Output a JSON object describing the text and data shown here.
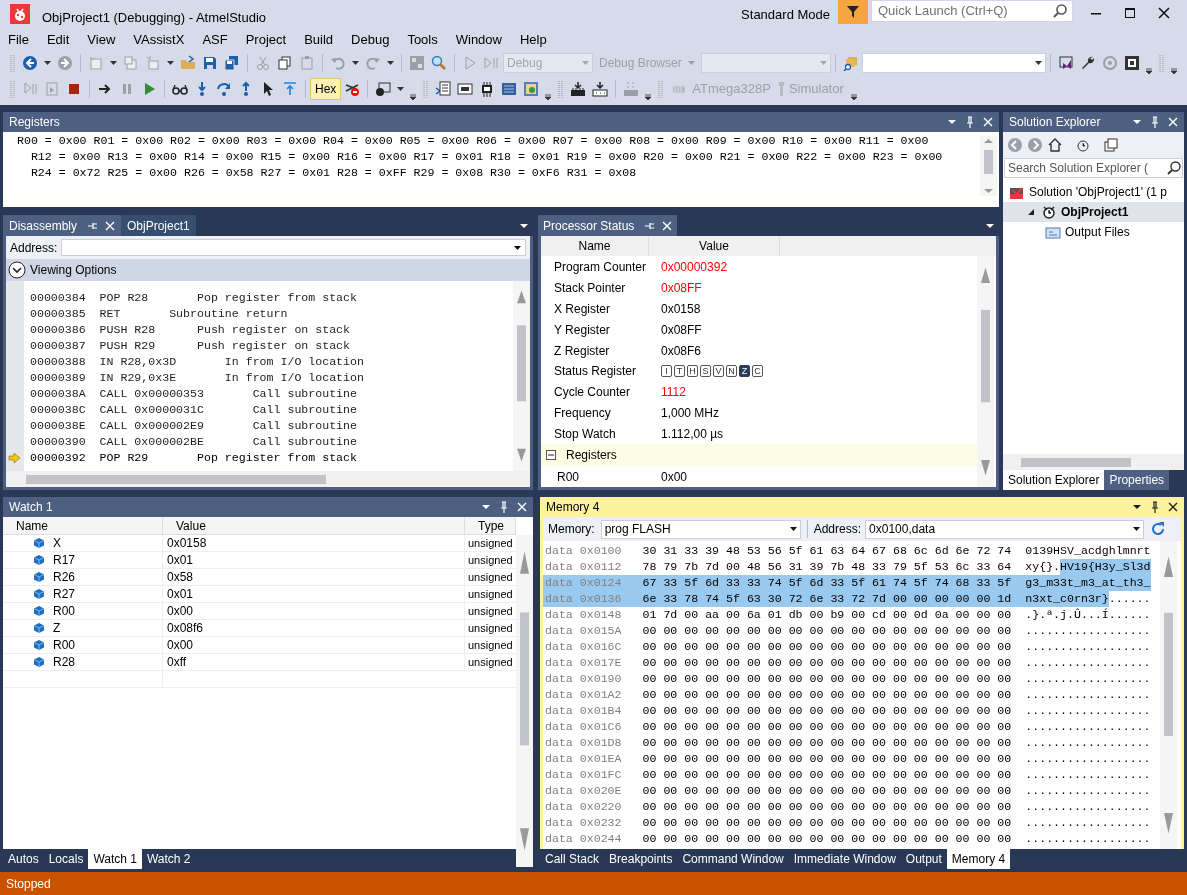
{
  "window": {
    "title": "ObjProject1 (Debugging) - AtmelStudio",
    "mode": "Standard Mode",
    "quick_launch": {
      "placeholder": "Quick Launch (Ctrl+Q)"
    }
  },
  "menu": [
    "File",
    "Edit",
    "View",
    "VAssistX",
    "ASF",
    "Project",
    "Build",
    "Debug",
    "Tools",
    "Window",
    "Help"
  ],
  "toolbar": {
    "configuration": {
      "value": "Debug",
      "disabled": true
    },
    "debug_browser": {
      "label": "Debug Browser",
      "disabled": true
    },
    "hex": {
      "label": "Hex",
      "selected": true
    },
    "device": {
      "label": "ATmega328P",
      "disabled": true
    },
    "tool": {
      "label": "Simulator",
      "disabled": true
    }
  },
  "registers_panel": {
    "title": "Registers",
    "lines": [
      "R00 = 0x00 R01 = 0x00 R02 = 0x00 R03 = 0x00 R04 = 0x00 R05 = 0x00 R06 = 0x00 R07 = 0x00 R08 = 0x00 R09 = 0x00 R10 = 0x00 R11 = 0x00",
      "  R12 = 0x00 R13 = 0x00 R14 = 0x00 R15 = 0x00 R16 = 0x00 R17 = 0x01 R18 = 0x01 R19 = 0x00 R20 = 0x00 R21 = 0x00 R22 = 0x00 R23 = 0x00",
      "  R24 = 0x72 R25 = 0x00 R26 = 0x58 R27 = 0x01 R28 = 0xFF R29 = 0x08 R30 = 0xF6 R31 = 0x08"
    ]
  },
  "disassembly": {
    "tabs": [
      {
        "label": "Disassembly",
        "selected": true
      },
      {
        "label": "ObjProject1",
        "selected": false
      }
    ],
    "address_label": "Address:",
    "viewing_options": {
      "label": "Viewing Options",
      "expanded": false
    },
    "lines": [
      {
        "text": "00000384  POP R28       Pop register from stack",
        "current": false
      },
      {
        "text": "00000385  RET       Subroutine return",
        "current": false
      },
      {
        "text": "00000386  PUSH R28      Push register on stack",
        "current": false
      },
      {
        "text": "00000387  PUSH R29      Push register on stack",
        "current": false
      },
      {
        "text": "00000388  IN R28,0x3D       In from I/O location",
        "current": false
      },
      {
        "text": "00000389  IN R29,0x3E       In from I/O location",
        "current": false
      },
      {
        "text": "0000038A  CALL 0x00000353       Call subroutine",
        "current": false
      },
      {
        "text": "0000038C  CALL 0x0000031C       Call subroutine",
        "current": false
      },
      {
        "text": "0000038E  CALL 0x000002E9       Call subroutine",
        "current": false
      },
      {
        "text": "00000390  CALL 0x000002BE       Call subroutine",
        "current": false
      },
      {
        "text": "00000392  POP R29       Pop register from stack",
        "current": true
      }
    ]
  },
  "processor_status": {
    "title": "Processor Status",
    "columns": [
      "Name",
      "Value"
    ],
    "rows": [
      {
        "kind": "value",
        "name": "Program Counter",
        "value": "0x00000392",
        "changed": true
      },
      {
        "kind": "value",
        "name": "Stack Pointer",
        "value": "0x08FF",
        "changed": true
      },
      {
        "kind": "value",
        "name": "X Register",
        "value": "0x0158",
        "changed": false
      },
      {
        "kind": "value",
        "name": "Y Register",
        "value": "0x08FF",
        "changed": false
      },
      {
        "kind": "value",
        "name": "Z Register",
        "value": "0x08F6",
        "changed": false
      },
      {
        "kind": "flags",
        "name": "Status Register",
        "flags": [
          {
            "flag": "I",
            "set": false
          },
          {
            "flag": "T",
            "set": false
          },
          {
            "flag": "H",
            "set": false
          },
          {
            "flag": "S",
            "set": false
          },
          {
            "flag": "V",
            "set": false
          },
          {
            "flag": "N",
            "set": false
          },
          {
            "flag": "Z",
            "set": true
          },
          {
            "flag": "C",
            "set": false
          }
        ]
      },
      {
        "kind": "value",
        "name": "Cycle Counter",
        "value": "1112",
        "changed": true
      },
      {
        "kind": "value",
        "name": "Frequency",
        "value": "1,000 MHz",
        "changed": false
      },
      {
        "kind": "value",
        "name": "Stop Watch",
        "value": "1.112,00 µs",
        "changed": false
      },
      {
        "kind": "group",
        "name": "Registers",
        "expanded": true
      },
      {
        "kind": "sub",
        "name": "R00",
        "value": "0x00",
        "changed": false
      }
    ]
  },
  "solution_explorer": {
    "title": "Solution Explorer",
    "search": {
      "placeholder": "Search Solution Explorer ("
    },
    "tree": [
      {
        "label": "Solution 'ObjProject1' (1 p",
        "kind": "solution",
        "selected": false,
        "children": [
          {
            "label": "ObjProject1",
            "kind": "project",
            "selected": true,
            "expanded": true,
            "children": [
              {
                "label": "Output Files",
                "kind": "folder",
                "selected": false
              }
            ]
          }
        ]
      }
    ],
    "tabs": [
      {
        "label": "Solution Explorer",
        "selected": true
      },
      {
        "label": "Properties",
        "selected": false
      }
    ]
  },
  "watch": {
    "title": "Watch 1",
    "columns": [
      "Name",
      "Value",
      "Type"
    ],
    "rows": [
      {
        "name": "X",
        "value": "0x0158",
        "type": "unsigned"
      },
      {
        "name": "R17",
        "value": "0x01",
        "type": "unsigned"
      },
      {
        "name": "R26",
        "value": "0x58",
        "type": "unsigned"
      },
      {
        "name": "R27",
        "value": "0x01",
        "type": "unsigned"
      },
      {
        "name": "R00",
        "value": "0x00",
        "type": "unsigned"
      },
      {
        "name": "Z",
        "value": "0x08f6",
        "type": "unsigned"
      },
      {
        "name": "R00",
        "value": "0x00",
        "type": "unsigned"
      },
      {
        "name": "R28",
        "value": "0xff",
        "type": "unsigned"
      }
    ],
    "tabs": [
      {
        "label": "Autos",
        "selected": false
      },
      {
        "label": "Locals",
        "selected": false
      },
      {
        "label": "Watch 1",
        "selected": true
      },
      {
        "label": "Watch 2",
        "selected": false
      }
    ]
  },
  "memory": {
    "title": "Memory 4",
    "memory_label": "Memory:",
    "memory_value": "prog FLASH",
    "address_label": "Address:",
    "address_value": "0x0100,data",
    "rows": [
      {
        "address": "data 0x0100",
        "bytes": "30 31 33 39 48 53 56 5f 61 63 64 67 68 6c 6d 6e 72 74",
        "selected": false,
        "ascii": [
          {
            "text": "0139HSV_acdghlmnrt",
            "selected": false
          }
        ]
      },
      {
        "address": "data 0x0112",
        "bytes": "78 79 7b 7d 00 48 56 31 39 7b 48 33 79 5f 53 6c 33 64",
        "selected": false,
        "ascii": [
          {
            "text": "xy{}.",
            "selected": false
          },
          {
            "text": "HV19{H3y_Sl3d",
            "selected": true
          }
        ]
      },
      {
        "address": "data 0x0124",
        "bytes": "67 33 5f 6d 33 33 74 5f 6d 33 5f 61 74 5f 74 68 33 5f",
        "selected": true,
        "ascii": [
          {
            "text": "g3_m33t_m3_at_th3_",
            "selected": true
          }
        ]
      },
      {
        "address": "data 0x0136",
        "bytes": "6e 33 78 74 5f 63 30 72 6e 33 72 7d 00 00 00 00 00 1d",
        "selected": true,
        "ascii": [
          {
            "text": "n3xt_c0rn3r}",
            "selected": true
          },
          {
            "text": "......",
            "selected": false
          }
        ]
      },
      {
        "address": "data 0x0148",
        "bytes": "01 7d 00 aa 00 6a 01 db 00 b9 00 cd 00 0d 0a 00 00 00",
        "selected": false,
        "ascii": [
          {
            "text": ".}.ª.j.Û...Í......",
            "selected": false
          }
        ]
      },
      {
        "address": "data 0x015A",
        "bytes": "00 00 00 00 00 00 00 00 00 00 00 00 00 00 00 00 00 00",
        "selected": false,
        "ascii": [
          {
            "text": "..................",
            "selected": false
          }
        ]
      },
      {
        "address": "data 0x016C",
        "bytes": "00 00 00 00 00 00 00 00 00 00 00 00 00 00 00 00 00 00",
        "selected": false,
        "ascii": [
          {
            "text": "..................",
            "selected": false
          }
        ]
      },
      {
        "address": "data 0x017E",
        "bytes": "00 00 00 00 00 00 00 00 00 00 00 00 00 00 00 00 00 00",
        "selected": false,
        "ascii": [
          {
            "text": "..................",
            "selected": false
          }
        ]
      },
      {
        "address": "data 0x0190",
        "bytes": "00 00 00 00 00 00 00 00 00 00 00 00 00 00 00 00 00 00",
        "selected": false,
        "ascii": [
          {
            "text": "..................",
            "selected": false
          }
        ]
      },
      {
        "address": "data 0x01A2",
        "bytes": "00 00 00 00 00 00 00 00 00 00 00 00 00 00 00 00 00 00",
        "selected": false,
        "ascii": [
          {
            "text": "..................",
            "selected": false
          }
        ]
      },
      {
        "address": "data 0x01B4",
        "bytes": "00 00 00 00 00 00 00 00 00 00 00 00 00 00 00 00 00 00",
        "selected": false,
        "ascii": [
          {
            "text": "..................",
            "selected": false
          }
        ]
      },
      {
        "address": "data 0x01C6",
        "bytes": "00 00 00 00 00 00 00 00 00 00 00 00 00 00 00 00 00 00",
        "selected": false,
        "ascii": [
          {
            "text": "..................",
            "selected": false
          }
        ]
      },
      {
        "address": "data 0x01D8",
        "bytes": "00 00 00 00 00 00 00 00 00 00 00 00 00 00 00 00 00 00",
        "selected": false,
        "ascii": [
          {
            "text": "..................",
            "selected": false
          }
        ]
      },
      {
        "address": "data 0x01EA",
        "bytes": "00 00 00 00 00 00 00 00 00 00 00 00 00 00 00 00 00 00",
        "selected": false,
        "ascii": [
          {
            "text": "..................",
            "selected": false
          }
        ]
      },
      {
        "address": "data 0x01FC",
        "bytes": "00 00 00 00 00 00 00 00 00 00 00 00 00 00 00 00 00 00",
        "selected": false,
        "ascii": [
          {
            "text": "..................",
            "selected": false
          }
        ]
      },
      {
        "address": "data 0x020E",
        "bytes": "00 00 00 00 00 00 00 00 00 00 00 00 00 00 00 00 00 00",
        "selected": false,
        "ascii": [
          {
            "text": "..................",
            "selected": false
          }
        ]
      },
      {
        "address": "data 0x0220",
        "bytes": "00 00 00 00 00 00 00 00 00 00 00 00 00 00 00 00 00 00",
        "selected": false,
        "ascii": [
          {
            "text": "..................",
            "selected": false
          }
        ]
      },
      {
        "address": "data 0x0232",
        "bytes": "00 00 00 00 00 00 00 00 00 00 00 00 00 00 00 00 00 00",
        "selected": false,
        "ascii": [
          {
            "text": "..................",
            "selected": false
          }
        ]
      },
      {
        "address": "data 0x0244",
        "bytes": "00 00 00 00 00 00 00 00 00 00 00 00 00 00 00 00 00 00",
        "selected": false,
        "ascii": [
          {
            "text": "..................",
            "selected": false
          }
        ]
      }
    ],
    "tabs": [
      {
        "label": "Call Stack",
        "selected": false
      },
      {
        "label": "Breakpoints",
        "selected": false
      },
      {
        "label": "Command Window",
        "selected": false
      },
      {
        "label": "Immediate Window",
        "selected": false
      },
      {
        "label": "Output",
        "selected": false
      },
      {
        "label": "Memory 4",
        "selected": true
      }
    ]
  },
  "status_bar": {
    "text": "Stopped"
  }
}
